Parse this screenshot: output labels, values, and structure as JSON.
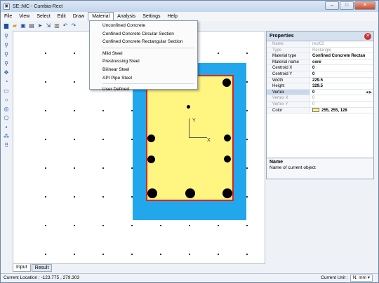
{
  "window": {
    "title": "SE::MC - Cumbia-Rect",
    "app_icon": "app-icon",
    "controls": [
      "minimize",
      "maximize",
      "close"
    ]
  },
  "menubar": {
    "items": [
      {
        "label": "File"
      },
      {
        "label": "View"
      },
      {
        "label": "Select"
      },
      {
        "label": "Edit"
      },
      {
        "label": "Draw"
      },
      {
        "label": "Material"
      },
      {
        "label": "Analysis"
      },
      {
        "label": "Settings"
      },
      {
        "label": "Help"
      }
    ],
    "active": "Material"
  },
  "material_menu": {
    "items": [
      {
        "label": "Unconfined Concrete"
      },
      {
        "label": "Confined Concrete Circular Section"
      },
      {
        "label": "Confined Concrete Rectangular Section"
      },
      {
        "separator": true
      },
      {
        "label": "Mild Steel"
      },
      {
        "label": "Prestressing Steel"
      },
      {
        "label": "Bilinear Steel"
      },
      {
        "label": "API Pipe Steel"
      },
      {
        "separator": true
      },
      {
        "label": "User Defined"
      }
    ]
  },
  "toolbar": {
    "icons": [
      "new-file-icon",
      "open-folder-icon",
      "save-icon",
      "print-icon",
      "select-pointer-icon",
      "select-multi-icon",
      "delete-icon",
      "undo-icon",
      "redo-icon"
    ]
  },
  "side_toolbar": {
    "icons": [
      "zoom-in-icon",
      "zoom-out-icon",
      "zoom-window-icon",
      "zoom-extents-icon",
      "pan-icon",
      "rotate-icon",
      "rectangle-icon",
      "circle-icon",
      "ring-icon",
      "polygon-icon",
      "point-icon",
      "circular-array-icon",
      "grid-array-icon"
    ]
  },
  "canvas": {
    "axis_x_label": "X",
    "axis_y_label": "Y",
    "colors": {
      "cover": "#22a7ec",
      "core": "#fff580",
      "core_border": "#e0221c",
      "rebar": "#000000"
    }
  },
  "properties": {
    "title": "Properties",
    "rows": [
      {
        "key": "Name",
        "value": "rect02",
        "state": "disabled"
      },
      {
        "key": "Type",
        "value": "Rectangle",
        "state": "disabled"
      },
      {
        "key": "Material type",
        "value": "Confined Concrete Rectan",
        "state": "bold"
      },
      {
        "key": "Material name",
        "value": "core",
        "state": "bold"
      },
      {
        "key": "Centroid  X",
        "value": "0",
        "state": "bold"
      },
      {
        "key": "Centroid  Y",
        "value": "0",
        "state": "bold"
      },
      {
        "key": "Width",
        "value": "229.5",
        "state": "bold"
      },
      {
        "key": "Height",
        "value": "329.5",
        "state": "bold"
      },
      {
        "key": "Vertex",
        "value": "0",
        "state": "selected"
      },
      {
        "key": "Vertex X",
        "value": "0",
        "state": "disabled"
      },
      {
        "key": "Vertex Y",
        "value": "0",
        "state": "disabled"
      },
      {
        "key": "Color",
        "value": "255, 255, 128",
        "state": "bold"
      }
    ],
    "description": {
      "title": "Name",
      "text": "Name of current object"
    }
  },
  "tabs": [
    {
      "label": "Input",
      "active": true
    },
    {
      "label": "Result",
      "active": false
    }
  ],
  "status": {
    "location_label": "Current Location :",
    "location_value": "-123.775 , 279.303",
    "unit_label": "Current Unit :",
    "unit_value": "N, mm"
  }
}
